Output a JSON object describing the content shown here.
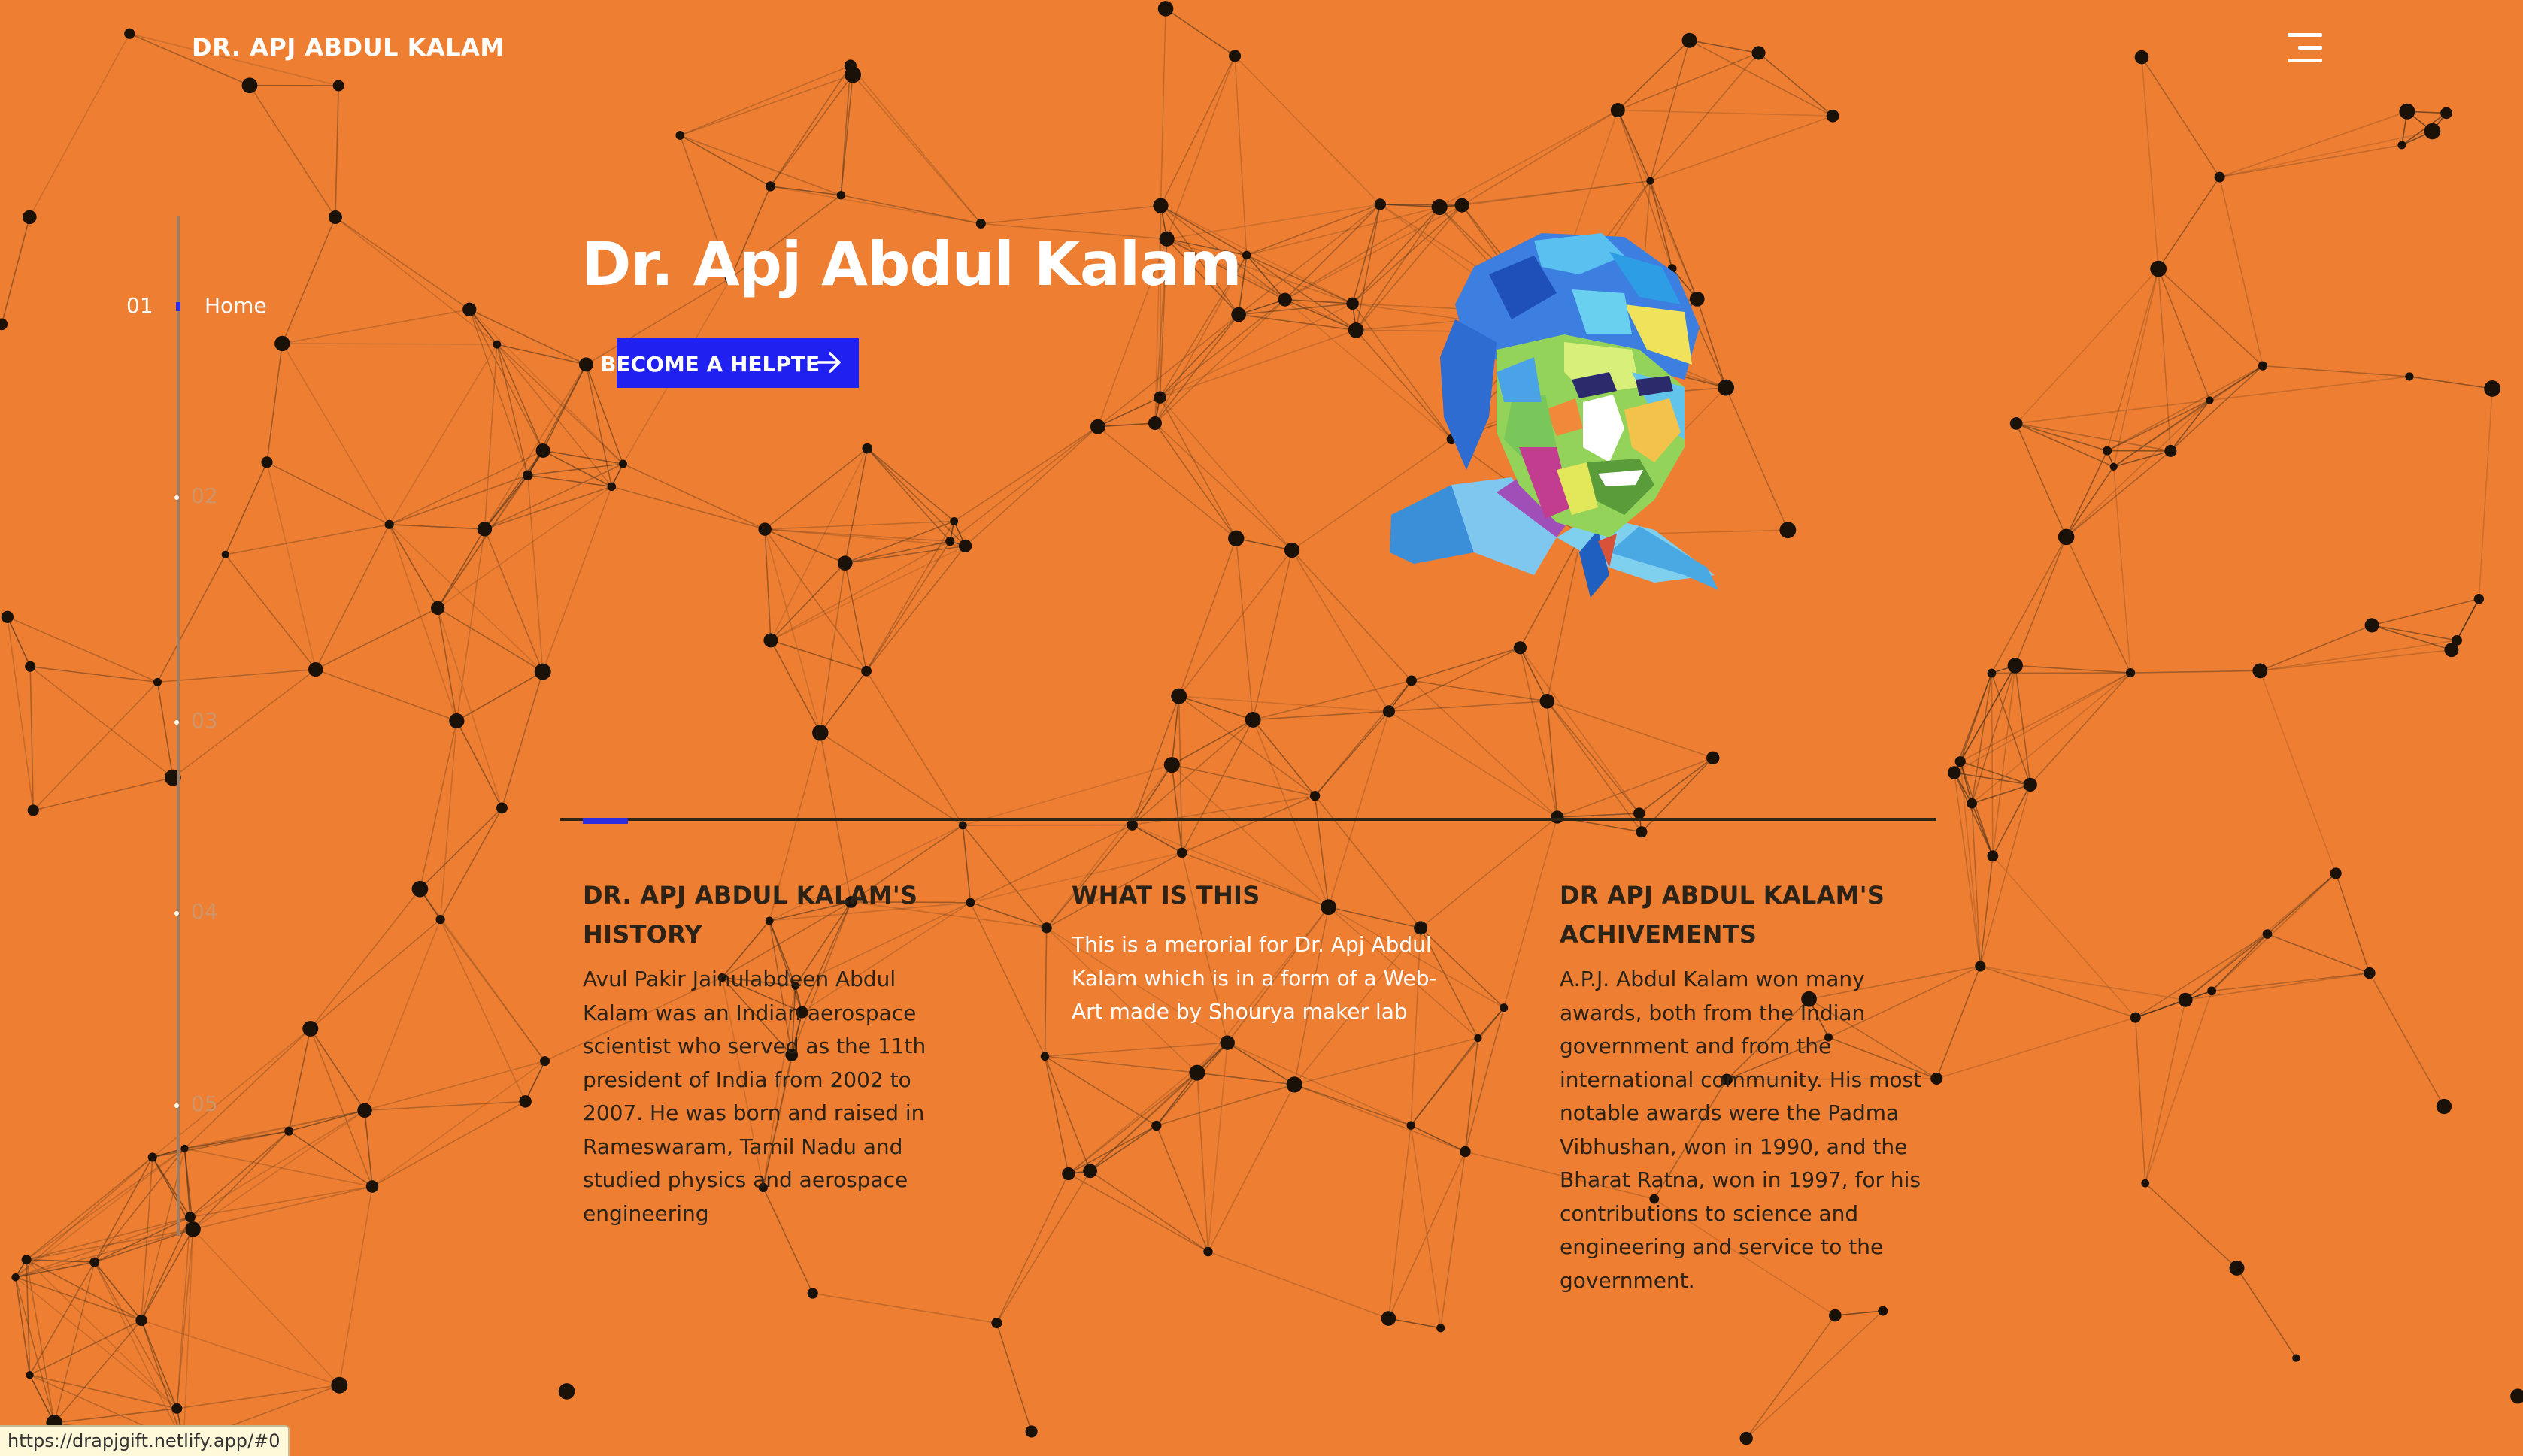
{
  "header": {
    "site_title": "DR. APJ ABDUL KALAM",
    "menu_icon": "hamburger-menu-icon"
  },
  "side_nav": {
    "items": [
      {
        "number": "01",
        "label": "Home",
        "active": true
      },
      {
        "number": "02",
        "label": "",
        "active": false
      },
      {
        "number": "03",
        "label": "",
        "active": false
      },
      {
        "number": "04",
        "label": "",
        "active": false
      },
      {
        "number": "05",
        "label": "",
        "active": false
      }
    ]
  },
  "hero": {
    "title": "Dr. Apj Abdul Kalam",
    "cta_label": "BECOME A HELPTE",
    "cta_icon": "arrow-right-icon",
    "portrait": "pop-art-portrait-illustration"
  },
  "sections": [
    {
      "heading_line1": "DR. APJ ABDUL KALAM'S",
      "heading_line2": "HISTORY",
      "body": "Avul Pakir Jainulabdeen Abdul Kalam was an Indian aerospace scientist who served as the 11th president of India from 2002 to 2007. He was born and raised in Rameswaram, Tamil Nadu and studied physics and aerospace engineering"
    },
    {
      "heading_line1": "WHAT IS THIS",
      "heading_line2": "",
      "body": "This is a merorial for Dr. Apj Abdul Kalam which is in a form of a Web-Art made by Shourya maker lab"
    },
    {
      "heading_line1": "DR APJ ABDUL KALAM'S",
      "heading_line2": "ACHIVEMENTS",
      "body": "A.P.J. Abdul Kalam won many awards, both from the Indian government and from the international community. His most notable awards were the Padma Vibhushan, won in 1990, and the Bharat Ratna, won in 1997, for his contributions to science and engineering and service to the government."
    }
  ],
  "status_bar": {
    "url": "https://drapjgift.netlify.app/#0"
  },
  "colors": {
    "background": "#ee7e31",
    "accent_blue": "#2020f0",
    "text_dark": "#2c2318",
    "text_light": "#ffffff",
    "network_lines": "#3a2a1a"
  }
}
